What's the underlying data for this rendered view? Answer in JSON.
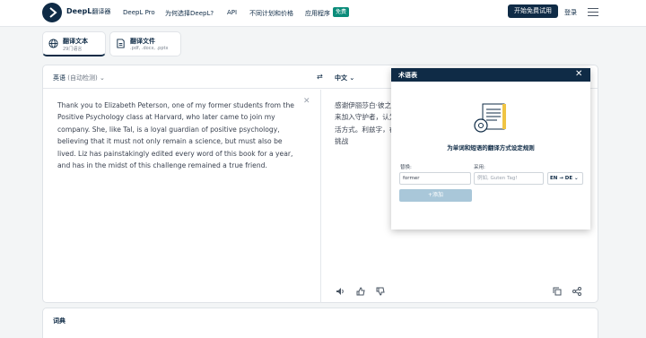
{
  "header": {
    "brand": "DeepL",
    "brand_suffix": "翻译器",
    "nav": [
      "DeepL Pro",
      "为何选择DeepL?",
      "API",
      "不同计划和价格",
      "应用程序"
    ],
    "new_badge": "免费",
    "cta": "开始免费试用",
    "login": "登录"
  },
  "modes": [
    {
      "title": "翻译文本",
      "subtitle": "29门语言"
    },
    {
      "title": "翻译文件",
      "subtitle": ".pdf, .docx, .pptx"
    }
  ],
  "translator": {
    "source_lang": "英语",
    "source_detect": "(自动检测)",
    "target_lang": "中文",
    "source_text": "Thank you to Elizabeth Peterson, one of my former students from the Positive Psychology class at Harvard, who later came to join my company. She, like Tal, is a loyal guardian of positive psychology, believing that it must not only remain a science, but must also be lived. Liz has painstakingly edited every word of this book for a year, and has in the midst of this challenge remained a true friend.",
    "target_text": "感谢伊丽莎白·彼之一，后来加入守护者，认为积生活方式。利兹字，在这一挑战"
  },
  "dictionary": {
    "label": "词典"
  },
  "glossary": {
    "title": "术语表",
    "description": "为单词和短语的翻译方式设定规则",
    "replace_label": "替换:",
    "use_label": "采用:",
    "replace_value": "former",
    "use_placeholder": "例如, Guten Tag!",
    "lang_pair": "EN → DE",
    "add_button": "+添加"
  },
  "colors": {
    "brand": "#0f2b46",
    "badge": "#0b8c7a",
    "add_button": "#a9c7d9"
  }
}
